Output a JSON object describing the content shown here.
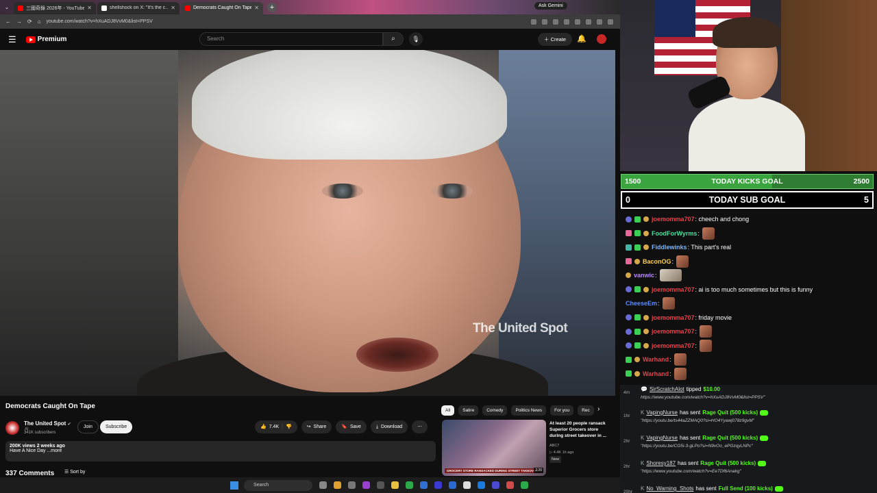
{
  "browser": {
    "tabs": [
      {
        "label": "三國奇錄 2026年 - YouTube",
        "color": "#ff0000"
      },
      {
        "label": "shellshock on X: \"It's the c…",
        "color": "#ffffff"
      },
      {
        "label": "Democrats Caught On Tape",
        "color": "#ff0000"
      }
    ],
    "ask_gemini": "Ask Gemini",
    "url": "youtube.com/watch?v=hXuADJ8VvM0&list=PPSV"
  },
  "youtube": {
    "logo_text": "Premium",
    "search_placeholder": "Search",
    "create_label": "Create",
    "video": {
      "watermark": "The United Spot",
      "title": "Democrats Caught On Tape",
      "channel_name": "The United Spot",
      "channel_tag": "AI",
      "subscribers": "341K subscribers",
      "join_label": "Join",
      "subscribe_label": "Subscribe",
      "likes": "7.4K",
      "share_label": "Share",
      "save_label": "Save",
      "download_label": "Download",
      "views_date": "200K views  2 weeks ago",
      "description": "Have A Nice Day ...more",
      "comments_count": "337 Comments",
      "sort_label": "Sort by"
    },
    "chips": [
      "All",
      "Satire",
      "Comedy",
      "Politics News",
      "For you",
      "Rec"
    ],
    "recommended": {
      "title": "At least 20 people ransack Superior Grocers store during street takeover in ...",
      "channel": "ABC7",
      "meta": "4.4K  1h ago",
      "badge": "New",
      "thumb_caption": "GROCERY STORE RANSACKED DURING STREET TAKEOVER",
      "duration": "2:20"
    }
  },
  "taskbar": {
    "search_label": "Search"
  },
  "stream": {
    "kicks_goal": {
      "current": "1500",
      "label": "TODAY KICKS GOAL",
      "target": "2500",
      "fraction": 0.6
    },
    "sub_goal": {
      "current": "0",
      "label": "TODAY SUB GOAL",
      "target": "5"
    },
    "chat": [
      {
        "badges": [
          "sub",
          "green",
          "coin"
        ],
        "user": "joemomma707",
        "color": "#e0454d",
        "text": ": cheech and chong",
        "emote": false
      },
      {
        "badges": [
          "pink",
          "green",
          "coin"
        ],
        "user": "FoodForWyrms",
        "color": "#43e0a0",
        "text": ":",
        "emote": true
      },
      {
        "badges": [
          "mod",
          "green",
          "coin"
        ],
        "user": "Fiddlewinks",
        "color": "#7ab8ff",
        "text": ": This part's real",
        "emote": false
      },
      {
        "badges": [
          "pink",
          "coin"
        ],
        "user": "BaconOG",
        "color": "#ffcf4a",
        "text": ":",
        "emote": true
      },
      {
        "badges": [
          "coin"
        ],
        "user": "vanwic",
        "color": "#b98aff",
        "text": ":",
        "emote": true,
        "wide": true
      },
      {
        "badges": [
          "sub",
          "green",
          "coin"
        ],
        "user": "joemomma707",
        "color": "#e0454d",
        "text": ": ai is too much sometimes but this is funny",
        "emote": false
      },
      {
        "badges": [],
        "user": "CheeseEm",
        "color": "#5a8cff",
        "text": ":",
        "emote": true
      },
      {
        "badges": [
          "sub",
          "green",
          "coin"
        ],
        "user": "joemomma707",
        "color": "#e0454d",
        "text": ": friday movie",
        "emote": false
      },
      {
        "badges": [
          "sub",
          "green",
          "coin"
        ],
        "user": "joemomma707",
        "color": "#e0454d",
        "text": ":",
        "emote": true
      },
      {
        "badges": [
          "sub",
          "green",
          "coin"
        ],
        "user": "joemomma707",
        "color": "#e0454d",
        "text": ":",
        "emote": true
      },
      {
        "badges": [
          "green",
          "coin"
        ],
        "user": "Warhand",
        "color": "#e0454d",
        "text": ":",
        "emote": true
      },
      {
        "badges": [
          "green",
          "coin"
        ],
        "user": "Warhand",
        "color": "#e0454d",
        "text": ":",
        "emote": true
      }
    ],
    "alerts": [
      {
        "age": "4m",
        "name": "SirScratchAlot",
        "action": " tipped ",
        "amount": "$10.00",
        "link": "https://www.youtube.com/watch?v=hXuADJ8VvM0&list=PPSV\"",
        "kind": "tip"
      },
      {
        "age": "1hr",
        "name": "VapingNurse",
        "action": " has sent ",
        "amount": "Rage Quit (500 kicks)",
        "link": "\"https://youtu.be/ts44aZZMAQ0?si=HO4Yyawj078z9gvM\"",
        "kind": "kick"
      },
      {
        "age": "2hr",
        "name": "VapingNurse",
        "action": " has sent ",
        "amount": "Rage Quit (500 kicks)",
        "link": "\"https://youtu.be/CG5i-3-gLPo?si=N9vOo_ePGzqyLNPc\"",
        "kind": "kick"
      },
      {
        "age": "2hr",
        "name": "Shoresy187",
        "action": " has sent ",
        "amount": "Rage Quit (500 kicks)",
        "link": "\"https://www.youtube.com/watch?v=EeTDf6Anakg\"",
        "kind": "kick"
      },
      {
        "age": "20hr",
        "name": "No_Warning_Shots",
        "action": " has sent ",
        "amount": "Full Send (100 kicks)",
        "link": "",
        "kind": "kick"
      }
    ]
  }
}
